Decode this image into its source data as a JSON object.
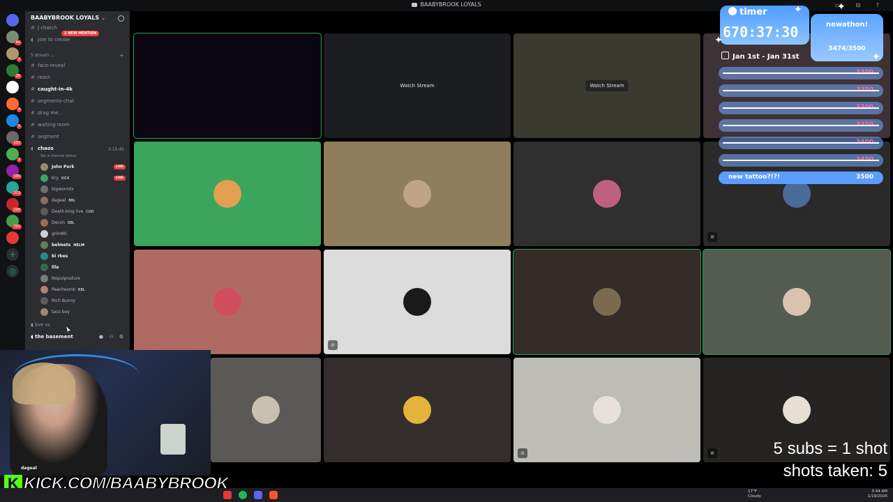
{
  "window": {
    "title": "BAABYBROOK LOYALS"
  },
  "server_rail": {
    "badges": [
      "44",
      "1",
      "26",
      "9",
      "5",
      "103",
      "3",
      "195",
      "313",
      "206",
      "703"
    ]
  },
  "sidebar": {
    "server_name": "BAABYBROOK LOYALS",
    "new_mention": "1 NEW MENTION",
    "channels_top": [
      {
        "label": "j chatch",
        "unread": false
      },
      {
        "label": "join to create",
        "unread": false
      }
    ],
    "category": "5 stream",
    "channels": [
      {
        "label": "face-reveal",
        "unread": false
      },
      {
        "label": "react",
        "unread": false
      },
      {
        "label": "caught-in-4k",
        "unread": true
      },
      {
        "label": "segments-chat",
        "unread": false
      },
      {
        "label": "drag me...",
        "unread": false
      },
      {
        "label": "waiting room",
        "unread": false
      },
      {
        "label": "segment",
        "unread": false
      }
    ],
    "voice_channel": {
      "name": "chaos",
      "elapsed": "3:15:45",
      "status": "Set a channel status",
      "members": [
        {
          "name": "John Pork",
          "tag": "",
          "live": "LIVE",
          "bold": true
        },
        {
          "name": "Kry",
          "tag": "KICK",
          "live": "LIVE",
          "bold": false
        },
        {
          "name": "bigwormtx",
          "tag": "",
          "live": "",
          "bold": false
        },
        {
          "name": "dageal",
          "tag": "BBL",
          "live": "",
          "bold": false
        },
        {
          "name": "Death king live",
          "tag": "COD",
          "live": "",
          "bold": false
        },
        {
          "name": "Decon",
          "tag": "BBL",
          "live": "",
          "bold": false
        },
        {
          "name": "grim80.",
          "tag": "",
          "live": "",
          "bold": false
        },
        {
          "name": "belmets",
          "tag": "HELM",
          "live": "",
          "bold": true
        },
        {
          "name": "bi rbes",
          "tag": "",
          "live": "",
          "bold": true
        },
        {
          "name": "lila",
          "tag": "",
          "live": "",
          "bold": true
        },
        {
          "name": "Nopulpnature",
          "tag": "",
          "live": "",
          "bold": false
        },
        {
          "name": "Peachesmk",
          "tag": "BBL",
          "live": "",
          "bold": false
        },
        {
          "name": "Rich Bunny",
          "tag": "",
          "live": "",
          "bold": false
        },
        {
          "name": "taco boy",
          "tag": "",
          "live": "",
          "bold": false
        }
      ]
    },
    "live_vc": "live vc",
    "basement": "the basement",
    "user": "dageal"
  },
  "grid": {
    "watch_stream": "Watch Stream",
    "tiles": [
      {
        "bg": "#0b0710",
        "kind": "stream",
        "speaking": true
      },
      {
        "bg": "#1c1d20",
        "kind": "watch"
      },
      {
        "bg": "#3a3a2e",
        "kind": "watch"
      },
      {
        "bg": "#3d3235",
        "kind": "stream"
      },
      {
        "bg": "#3ba55d",
        "kind": "avatar",
        "avatar": "#e0a050"
      },
      {
        "bg": "#8f7d5c",
        "kind": "avatar",
        "avatar": "#bfa48a"
      },
      {
        "bg": "#2f2f2f",
        "kind": "avatar",
        "avatar": "#c06080"
      },
      {
        "bg": "#2a2a2a",
        "kind": "avatar",
        "avatar": "#4a6a9a",
        "muted": true
      },
      {
        "bg": "#b06a64",
        "kind": "avatar",
        "avatar": "#d14e5e"
      },
      {
        "bg": "#dcdcdc",
        "kind": "avatar",
        "avatar": "#1a1a1a",
        "muted": true
      },
      {
        "bg": "#352b27",
        "kind": "avatar",
        "avatar": "#7a6a50",
        "speaking": true
      },
      {
        "bg": "#545c52",
        "kind": "avatar",
        "avatar": "#d9c2b0",
        "speaking": true
      },
      {
        "bg": "#5a5955",
        "kind": "avatar",
        "avatar": "#c8c0b0"
      },
      {
        "bg": "#332e2c",
        "kind": "avatar",
        "avatar": "#e4b43a"
      },
      {
        "bg": "#bdbcb7",
        "kind": "avatar",
        "avatar": "#e8e0dc",
        "muted": true
      },
      {
        "bg": "#252423",
        "kind": "avatar",
        "avatar": "#e6dfd3",
        "muted": true
      }
    ]
  },
  "overlay": {
    "timer_label": "timer",
    "timer_value": "670:37:30",
    "goal_title": "newathon!",
    "goal_count": "3474/3500",
    "date_range": "Jan 1st - Jan 31st",
    "goals": [
      {
        "text": "",
        "num": "3300",
        "done": true
      },
      {
        "text": "",
        "num": "3350",
        "done": true
      },
      {
        "text": "",
        "num": "3300",
        "done": true
      },
      {
        "text": "",
        "num": "3350",
        "done": true
      },
      {
        "text": "",
        "num": "3400",
        "done": true
      },
      {
        "text": "",
        "num": "3450",
        "done": true
      },
      {
        "text": "new tattoo?!?!",
        "num": "3500",
        "done": false
      }
    ],
    "subs_rule": "5 subs = 1 shot",
    "shots_taken": "shots taken: 5",
    "kick_url": "KICK.COM/BAABYBROOK",
    "kick_letter": "K"
  },
  "taskbar": {
    "weather_temp": "17°F",
    "weather_desc": "Cloudy",
    "time": "3:44 AM",
    "date": "1/19/2026"
  }
}
